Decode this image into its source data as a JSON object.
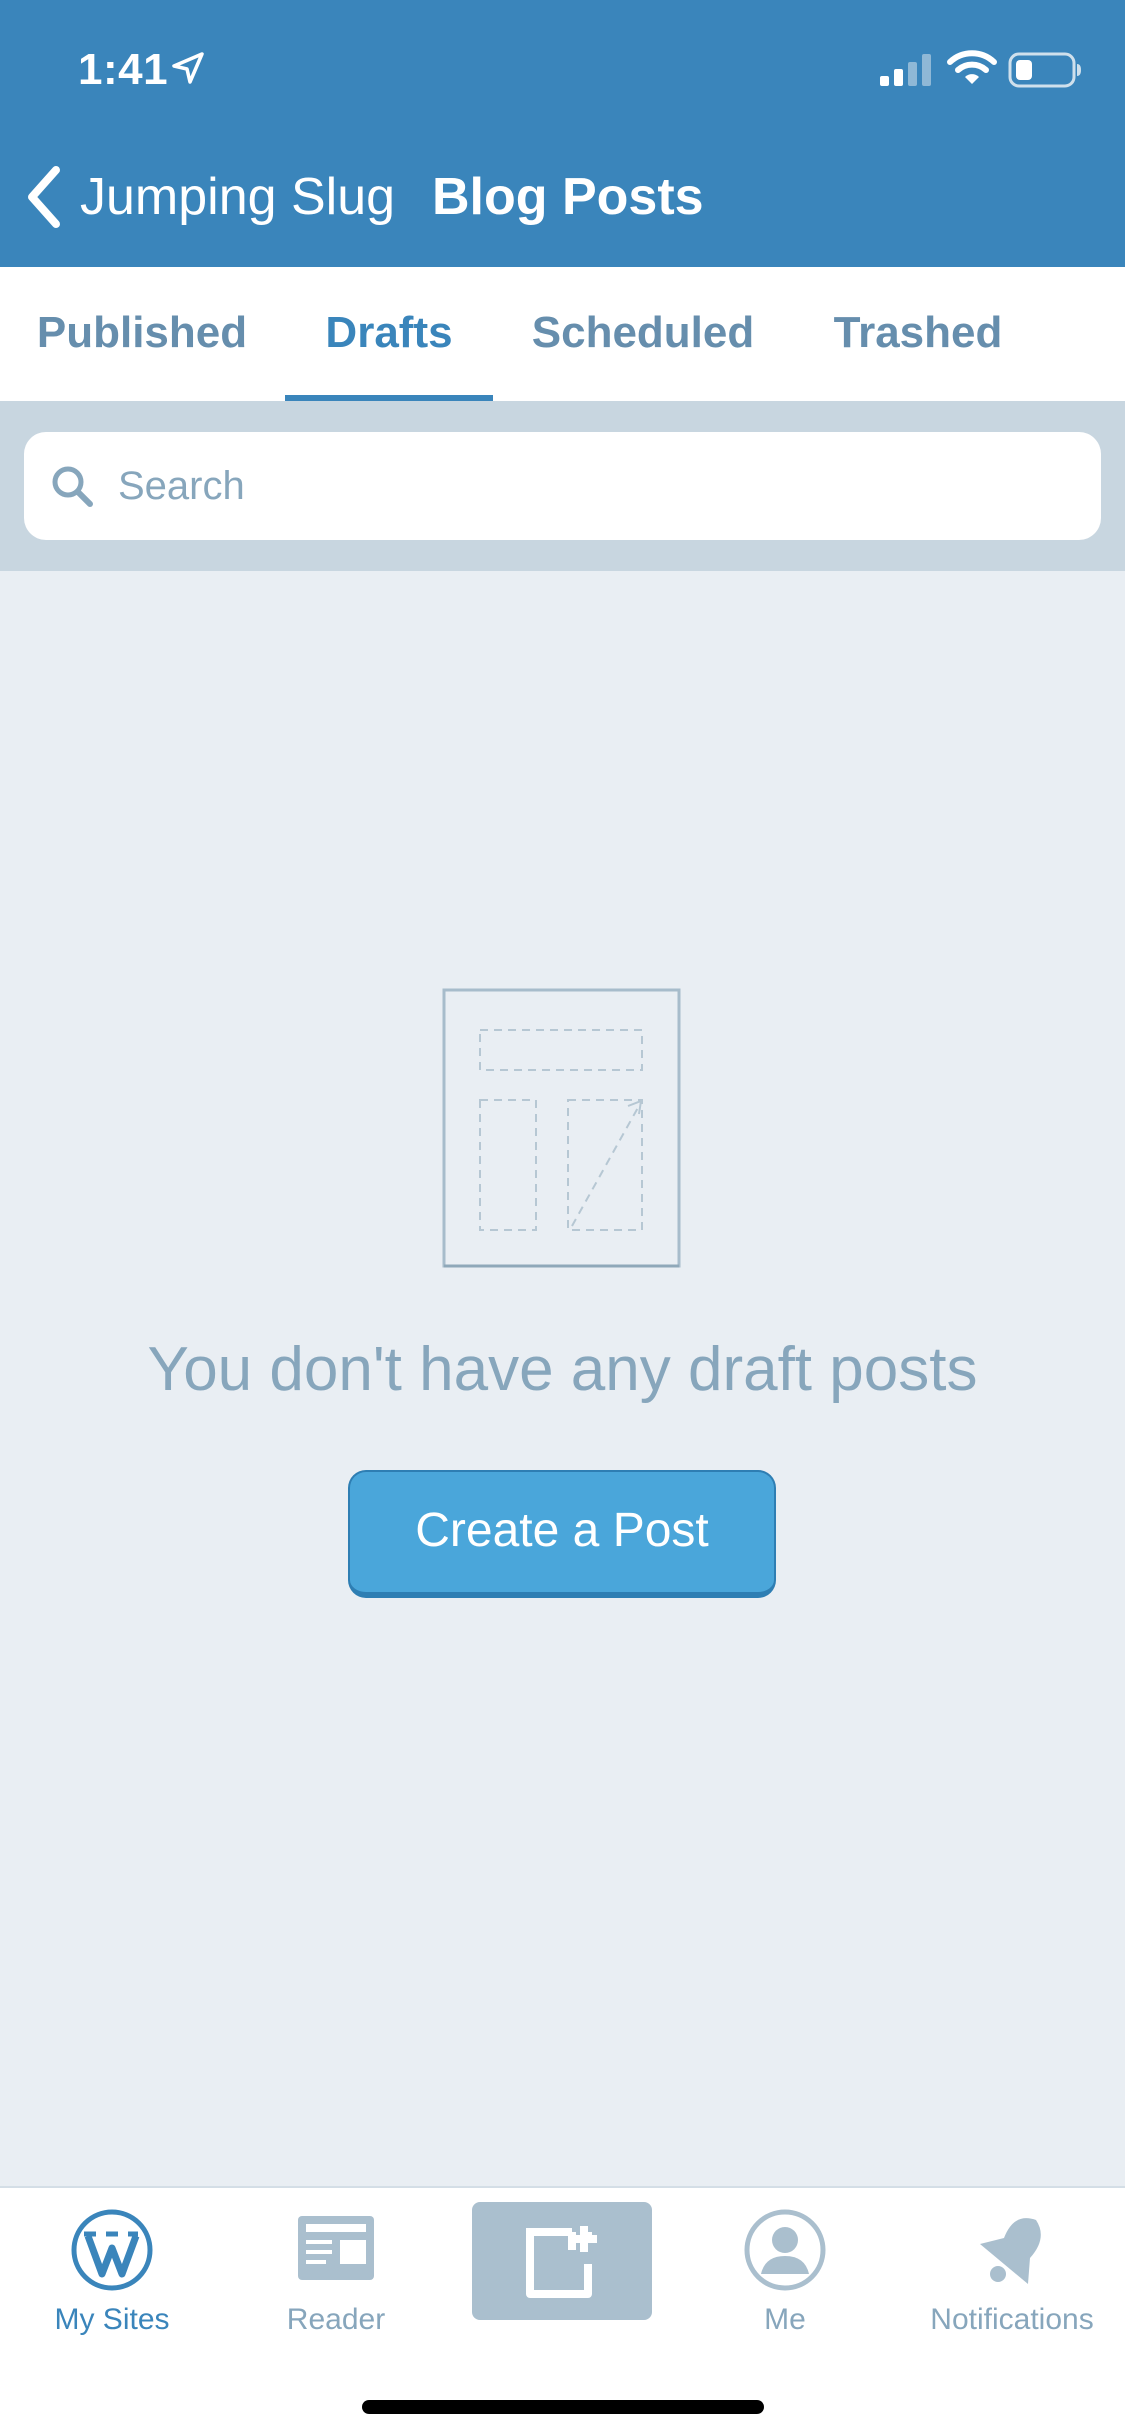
{
  "status_bar": {
    "time": "1:41",
    "location_icon": "location-arrow-icon",
    "signal_icon": "cellular-signal-icon",
    "wifi_icon": "wifi-icon",
    "battery_icon": "battery-icon"
  },
  "nav": {
    "back_label": "Jumping Slug",
    "back_icon": "chevron-left-icon",
    "title": "Blog Posts"
  },
  "tabs": [
    {
      "label": "Published",
      "active": false
    },
    {
      "label": "Drafts",
      "active": true
    },
    {
      "label": "Scheduled",
      "active": false
    },
    {
      "label": "Trashed",
      "active": false
    }
  ],
  "search": {
    "placeholder": "Search",
    "value": "",
    "icon": "search-icon"
  },
  "empty_state": {
    "illustration": "empty-post-illustration",
    "message": "You don't have any draft posts",
    "button_label": "Create a Post"
  },
  "tab_bar": {
    "items": [
      {
        "label": "My Sites",
        "icon": "wordpress-logo-icon",
        "active": true
      },
      {
        "label": "Reader",
        "icon": "reader-icon",
        "active": false
      },
      {
        "label": "",
        "icon": "write-post-icon",
        "active": false
      },
      {
        "label": "Me",
        "icon": "profile-icon",
        "active": false
      },
      {
        "label": "Notifications",
        "icon": "bell-icon",
        "active": false
      }
    ]
  },
  "colors": {
    "brand_blue": "#3a85bb",
    "button_blue": "#4aa6da",
    "background": "#e9eef3",
    "muted_text": "#87a6bc"
  }
}
